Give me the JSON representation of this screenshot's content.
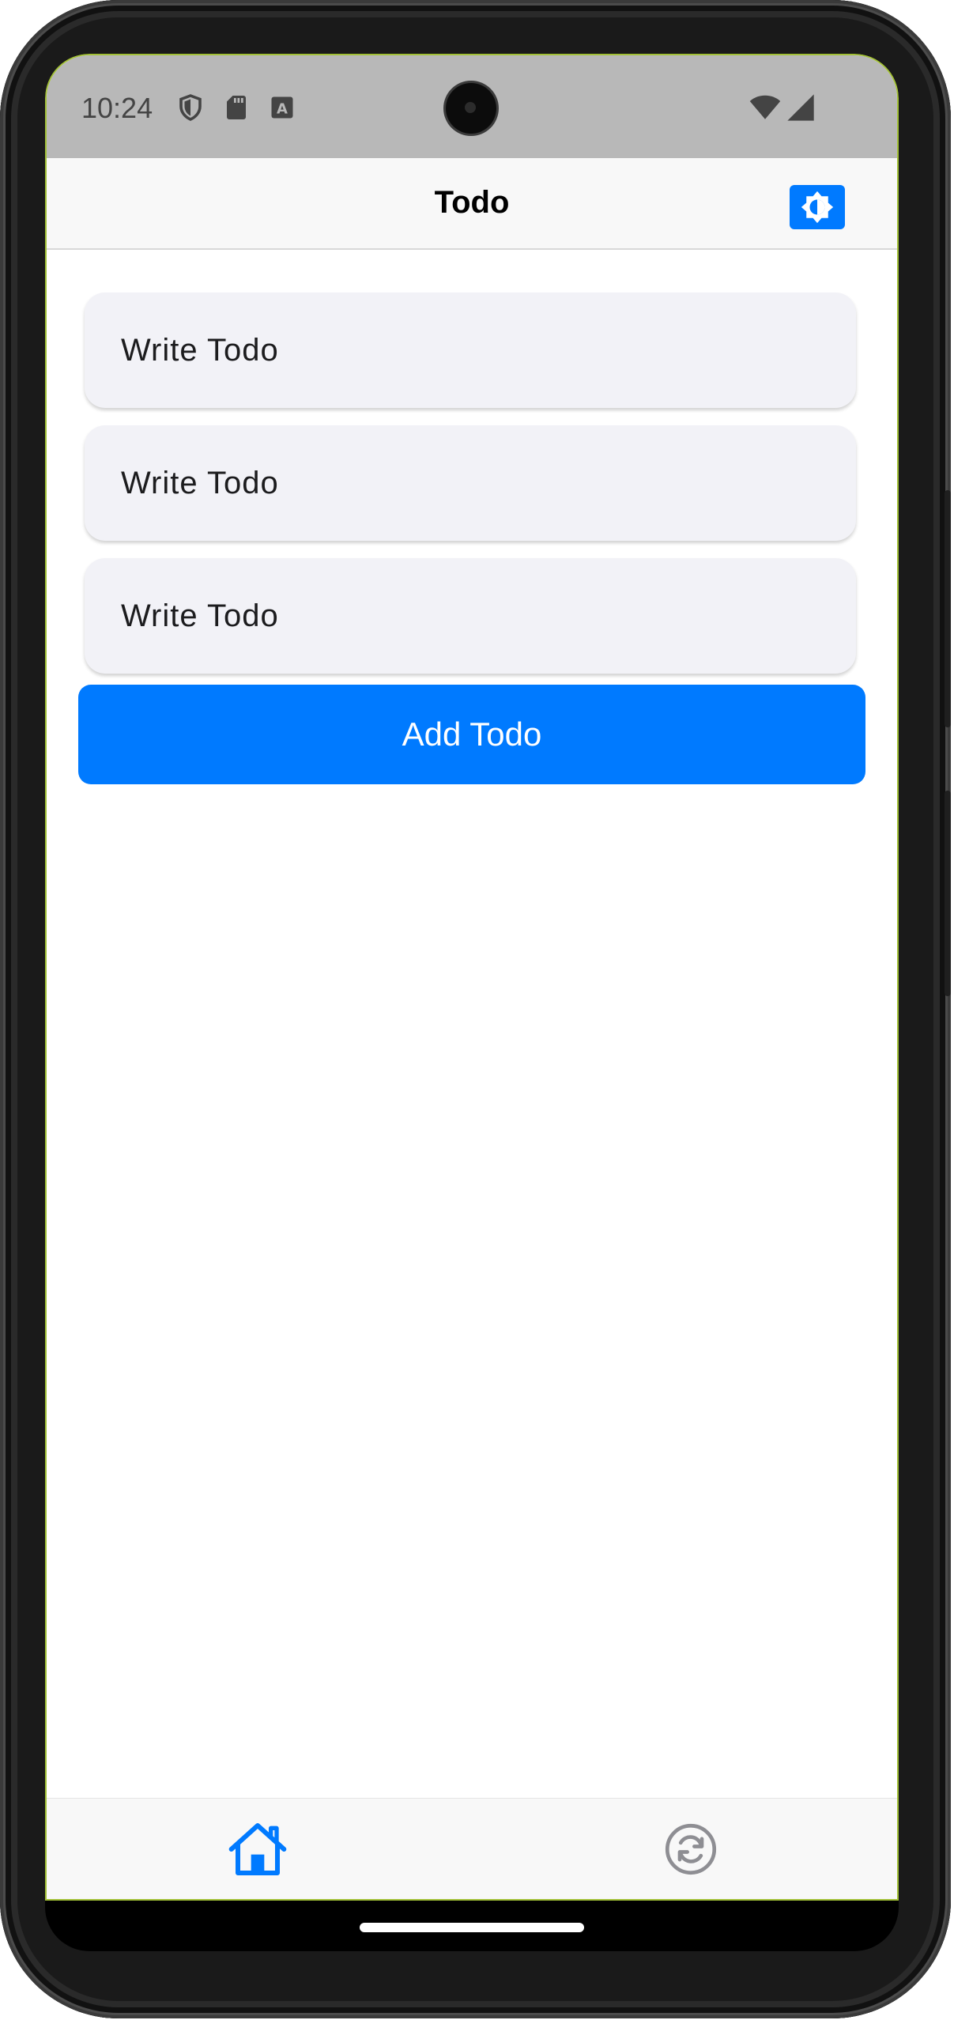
{
  "status_bar": {
    "time": "10:24",
    "icons": [
      "shield-icon",
      "sd-card-icon",
      "keyboard-a-icon",
      "wifi-icon",
      "signal-icon"
    ]
  },
  "header": {
    "title": "Todo",
    "theme_toggle_icon": "brightness-icon"
  },
  "todos": [
    {
      "placeholder": "Write Todo",
      "value": ""
    },
    {
      "placeholder": "Write Todo",
      "value": ""
    },
    {
      "placeholder": "Write Todo",
      "value": ""
    }
  ],
  "add_button": {
    "label": "Add Todo"
  },
  "tab_bar": {
    "tabs": [
      {
        "icon": "home-icon",
        "active": true
      },
      {
        "icon": "sync-icon",
        "active": false
      }
    ]
  },
  "colors": {
    "accent": "#007aff",
    "status_bar": "#b8b8b8",
    "todo_background": "#f2f2f7",
    "inactive_icon": "#8e8e93"
  }
}
